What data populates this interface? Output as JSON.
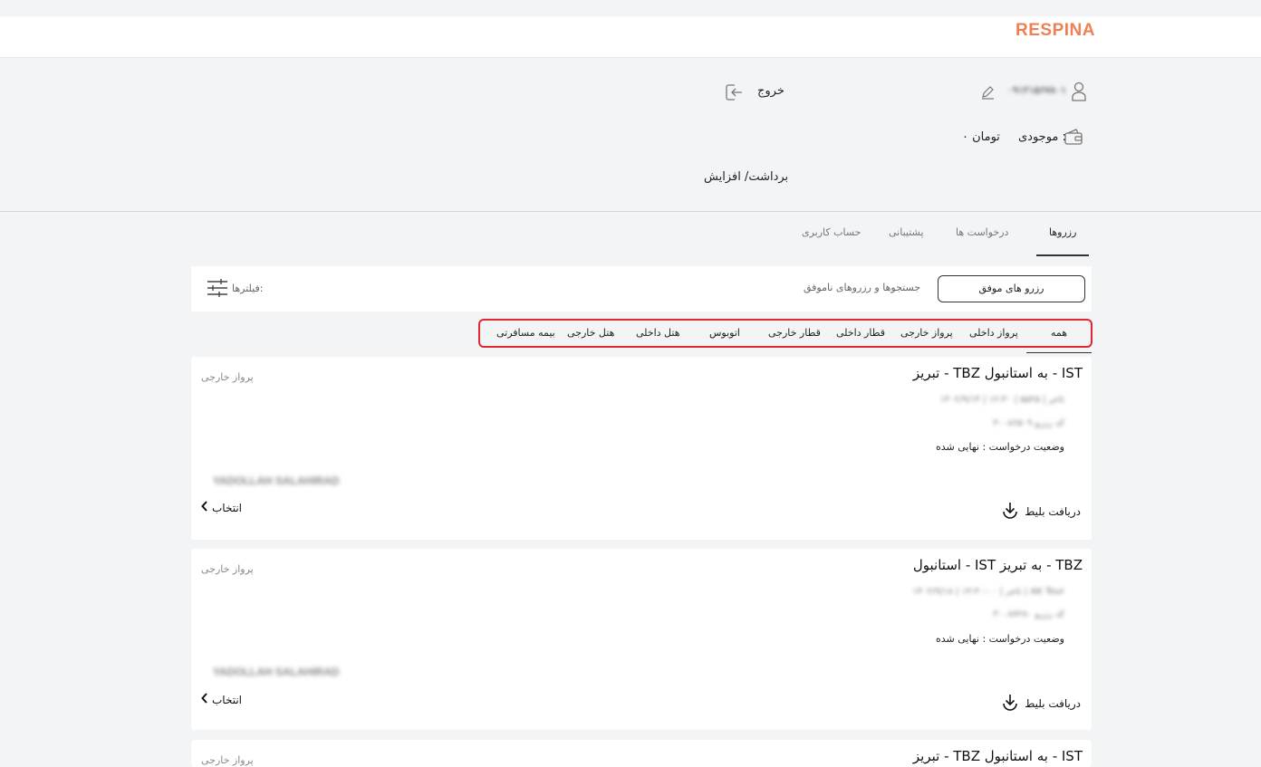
{
  "header": {
    "logo": "RESPINA"
  },
  "profile": {
    "phone": "۰۹۱۲۱۵۶۷۸۰۱",
    "logout_label": "خروج",
    "balance_label": "موجودی :",
    "balance_value": "۰ تومان",
    "withdraw_label": "برداشت/ افزایش"
  },
  "tabs": [
    {
      "label": "رزروها",
      "active": true
    },
    {
      "label": "درخواست ها",
      "active": false
    },
    {
      "label": "پشتیبانی",
      "active": false
    },
    {
      "label": "حساب کاربری",
      "active": false
    }
  ],
  "filterbar": {
    "success_label": "رزرو های موفق",
    "failed_label": "جستجوها و رزروهای ناموفق",
    "filters_label": "فیلترها:"
  },
  "categories": [
    "همه",
    "پرواز داخلی",
    "پرواز خارجی",
    "قطار داخلی",
    "قطار خارجی",
    "اتوبوس",
    "هتل داخلی",
    "هتل خارجی",
    "بیمه مسافرتی"
  ],
  "bookings": [
    {
      "title": "تبریز - TBZ به استانبول - IST",
      "type": "پرواز خارجی",
      "datetime": "۱۴۰۲/۹/۱۴ | ۱۲:۳۰ | تاجر | ۵۵۲۵",
      "booking_code": "کد رزرو ۳۰۰۸۶۵۰۹",
      "status": "وضعیت درخواست : نهایی شده",
      "passenger": "YADOLLAH SALAHIRAD",
      "select_label": "انتخاب",
      "download_label": "دریافت بلیط"
    },
    {
      "title": "استانبول - IST به تبریز - TBZ",
      "type": "پرواز خارجی",
      "datetime": "۱۴۰۲/۹/۱۸ | ۱۳:۳۰:۰۰ | تاجر | AK Tour",
      "booking_code": "کد رزرو ۳۰۰۸۷۲۸۰",
      "status": "وضعیت درخواست : نهایی شده",
      "passenger": "YADOLLAH SALAHIRAD",
      "select_label": "انتخاب",
      "download_label": "دریافت بلیط"
    },
    {
      "title": "تبریز - TBZ به استانبول - IST",
      "type": "پرواز خارجی"
    }
  ]
}
